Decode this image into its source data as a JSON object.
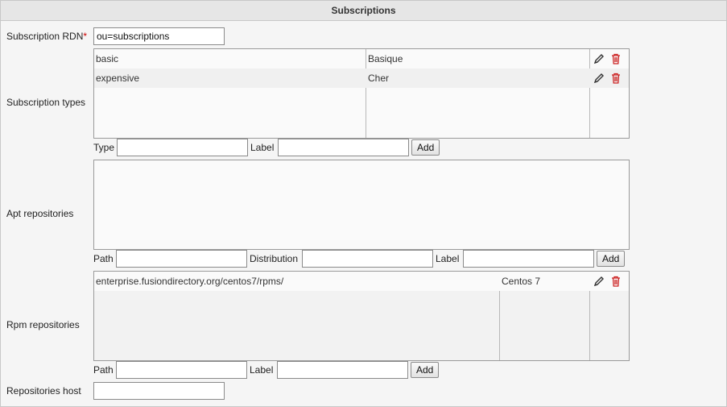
{
  "header": {
    "title": "Subscriptions"
  },
  "rdn": {
    "label": "Subscription RDN",
    "required_marker": "*",
    "value": "ou=subscriptions"
  },
  "subscription_types": {
    "label": "Subscription types",
    "rows": [
      {
        "type": "basic",
        "label": "Basique"
      },
      {
        "type": "expensive",
        "label": "Cher"
      }
    ],
    "add": {
      "type_label": "Type",
      "label_label": "Label",
      "button": "Add"
    }
  },
  "apt": {
    "label": "Apt repositories",
    "add": {
      "path_label": "Path",
      "distribution_label": "Distribution",
      "label_label": "Label",
      "button": "Add"
    }
  },
  "rpm": {
    "label": "Rpm repositories",
    "rows": [
      {
        "path": "enterprise.fusiondirectory.org/centos7/rpms/",
        "label": "Centos 7"
      }
    ],
    "add": {
      "path_label": "Path",
      "label_label": "Label",
      "button": "Add"
    }
  },
  "repo_host": {
    "label": "Repositories host",
    "value": ""
  },
  "icons": {
    "edit": "pencil-icon",
    "delete": "trash-icon",
    "delete_color": "#cc2222"
  }
}
